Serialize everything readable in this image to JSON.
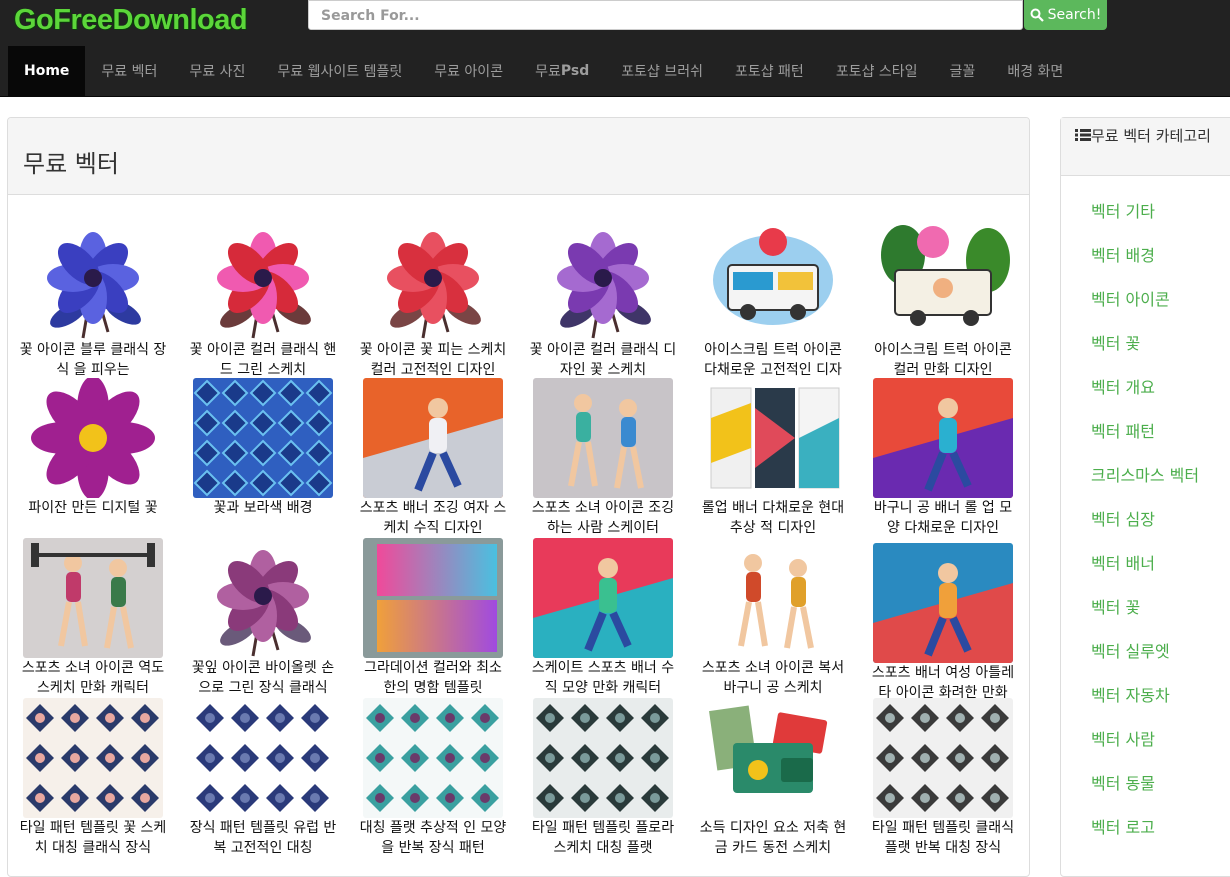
{
  "header": {
    "logo": "GoFreeDownload",
    "search_placeholder": "Search For...",
    "search_button": "Search!",
    "nav": [
      {
        "label": "Home",
        "active": true
      },
      {
        "label": "무료 벡터"
      },
      {
        "label": "무료 사진"
      },
      {
        "label": "무료 웹사이트 템플릿"
      },
      {
        "label": "무료 아이콘"
      },
      {
        "label": "무료 ",
        "bold_suffix": "Psd"
      },
      {
        "label": "포토샵 브러쉬"
      },
      {
        "label": "포토샵 패턴"
      },
      {
        "label": "포토샵 스타일"
      },
      {
        "label": "글꼴"
      },
      {
        "label": "배경 화면"
      }
    ]
  },
  "main": {
    "title": "무료 벡터",
    "items": [
      {
        "caption": "꽃 아이콘 블루 클래식 장식 을 피우는",
        "thumb": "flower-blue"
      },
      {
        "caption": "꽃 아이콘 컬러 클래식 핸드 그린 스케치",
        "thumb": "flower-red-pink"
      },
      {
        "caption": "꽃 아이콘 꽃 피는 스케치 컬러 고전적인 디자인",
        "thumb": "flower-red"
      },
      {
        "caption": "꽃 아이콘 컬러 클래식 디자인 꽃 스케치",
        "thumb": "flower-purple"
      },
      {
        "caption": "아이스크림 트럭 아이콘 다채로운 고전적인 디자인",
        "thumb": "icecream-truck"
      },
      {
        "caption": "아이스크림 트럭 아이콘 컬러 만화 디자인",
        "thumb": "icecream-truck-2"
      },
      {
        "caption": "파이잔 만든 디지털 꽃",
        "thumb": "cosmos-flower"
      },
      {
        "caption": "꽃과 보라색 배경",
        "thumb": "blue-pattern"
      },
      {
        "caption": "스포츠 배너 조깅 여자 스케치 수직 디자인",
        "thumb": "jogging-banner"
      },
      {
        "caption": "스포츠 소녀 아이콘 조깅하는 사람 스케이터",
        "thumb": "skater-girls"
      },
      {
        "caption": "롤업 배너 다채로운 현대 추상 적 디자인",
        "thumb": "rollup-banner"
      },
      {
        "caption": "바구니 공 배너 롤 업 모양 다채로운 디자인",
        "thumb": "basketball-banner"
      },
      {
        "caption": "스포츠 소녀 아이콘 역도 스케치 만화 캐릭터",
        "thumb": "weightlifting"
      },
      {
        "caption": "꽃잎 아이콘 바이올렛 손으로 그린 장식 클래식",
        "thumb": "violet-flower"
      },
      {
        "caption": "그라데이션 컬러와 최소한의 명함 템플릿",
        "thumb": "business-card"
      },
      {
        "caption": "스케이트 스포츠 배너 수직 모양 만화 캐릭터",
        "thumb": "skate-banner"
      },
      {
        "caption": "스포츠 소녀 아이콘 복서 바구니 공 스케치",
        "thumb": "boxer-girls"
      },
      {
        "caption": "스포츠 배너 여성 아틀레타 아이콘 화려한 만화",
        "thumb": "athlete-banner"
      },
      {
        "caption": "타일 패턴 템플릿 꽃 스케치 대칭 클래식 장식",
        "thumb": "tile-1"
      },
      {
        "caption": "장식 패턴 템플릿 유럽 반복 고전적인 대칭",
        "thumb": "tile-2"
      },
      {
        "caption": "대칭 플랫 추상적 인 모양을 반복 장식 패턴",
        "thumb": "tile-3"
      },
      {
        "caption": "타일 패턴 템플릿 플로라 스케치 대칭 플랫",
        "thumb": "tile-4"
      },
      {
        "caption": "소득 디자인 요소 저축 현금 카드 동전 스케치",
        "thumb": "wallet"
      },
      {
        "caption": "타일 패턴 템플릿 클래식 플랫 반복 대칭 장식",
        "thumb": "tile-5"
      }
    ]
  },
  "sidebar": {
    "title": "무료 벡터 카테고리",
    "items": [
      "벡터 기타",
      "벡터 배경",
      "벡터 아이콘",
      "벡터 꽃",
      "벡터 개요",
      "벡터 패턴",
      "크리스마스 벡터",
      "벡터 심장",
      "벡터 배너",
      "벡터 꽃",
      "벡터 실루엣",
      "벡터 자동차",
      "벡터 사람",
      "벡터 동물",
      "벡터 로고"
    ]
  },
  "colors": {
    "navbar": "#222222",
    "accent_green": "#5cb85c",
    "link_green": "#4cae4c",
    "logo_green": "#5cd63a"
  }
}
